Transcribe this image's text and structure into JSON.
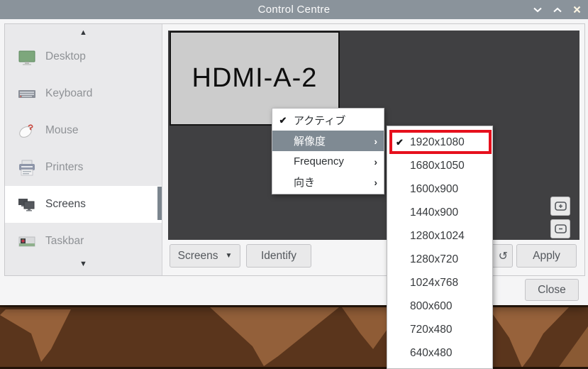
{
  "window": {
    "title": "Control Centre"
  },
  "sidebar": {
    "scroll_up": "▲",
    "scroll_down": "▼",
    "items": [
      {
        "label": "Desktop",
        "selected": false
      },
      {
        "label": "Keyboard",
        "selected": false
      },
      {
        "label": "Mouse",
        "selected": false
      },
      {
        "label": "Printers",
        "selected": false
      },
      {
        "label": "Screens",
        "selected": true
      },
      {
        "label": "Taskbar",
        "selected": false
      }
    ]
  },
  "preview": {
    "monitor_label": "HDMI-A-2",
    "zoom_in": "+",
    "zoom_out": "−"
  },
  "toolbar": {
    "screens_label": "Screens",
    "screens_arrow": "▼",
    "identify_label": "Identify",
    "undo_icon": "↺",
    "apply_label": "Apply"
  },
  "footer": {
    "close_label": "Close"
  },
  "context_menu": {
    "check": "✔",
    "arrow": "›",
    "items": [
      {
        "label": "アクティブ",
        "checked": true,
        "highlighted": false,
        "has_submenu": false
      },
      {
        "label": "解像度",
        "checked": false,
        "highlighted": true,
        "has_submenu": true
      },
      {
        "label": "Frequency",
        "checked": false,
        "highlighted": false,
        "has_submenu": true
      },
      {
        "label": "向き",
        "checked": false,
        "highlighted": false,
        "has_submenu": true
      }
    ]
  },
  "resolution_submenu": {
    "check": "✔",
    "checked_item": "1920x1080",
    "items": [
      "1920x1080",
      "1680x1050",
      "1600x900",
      "1440x900",
      "1280x1024",
      "1280x720",
      "1024x768",
      "800x600",
      "720x480",
      "640x480"
    ]
  },
  "colors": {
    "titlebar": "#8a939b",
    "menu_highlight": "#7f8a93",
    "canvas": "#404042",
    "annotation_red": "#e6101d"
  }
}
